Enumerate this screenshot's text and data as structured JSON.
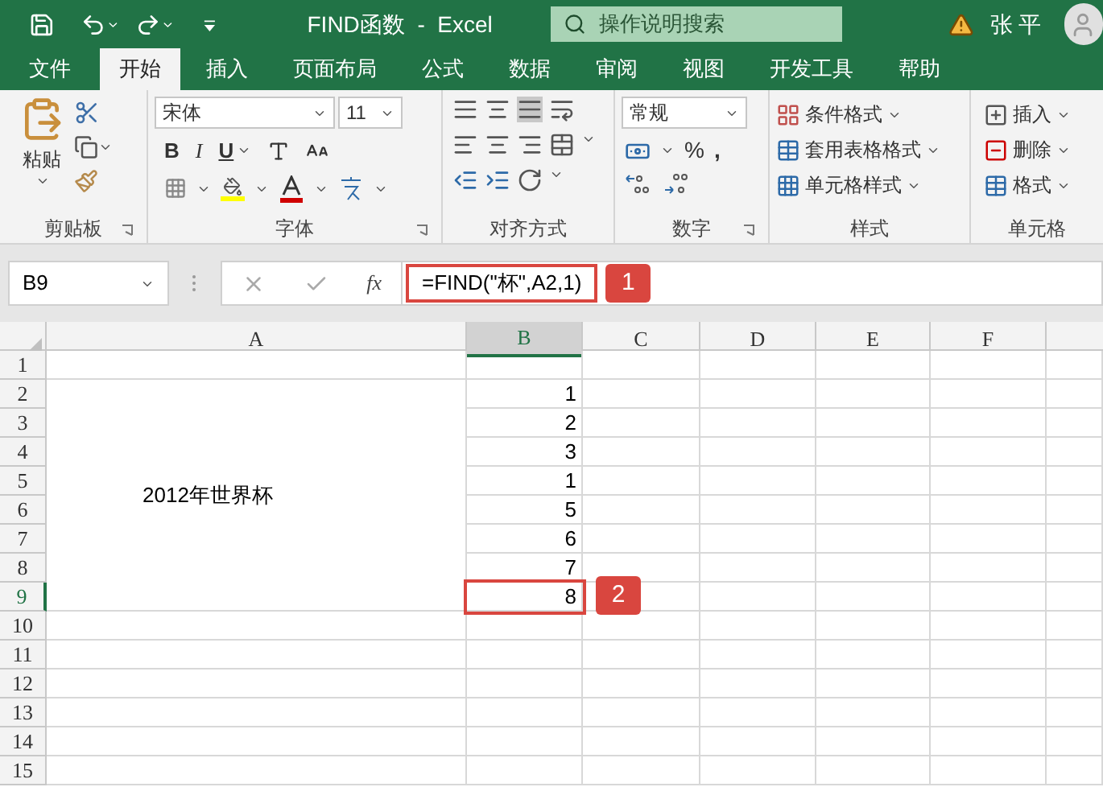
{
  "title_bar": {
    "title": "FIND函数  -  Excel",
    "search": {
      "placeholder": "操作说明搜索"
    },
    "user": "张 平"
  },
  "tabs": [
    {
      "label": "文件",
      "selected": false
    },
    {
      "label": "开始",
      "selected": true
    },
    {
      "label": "插入",
      "selected": false
    },
    {
      "label": "页面布局",
      "selected": false
    },
    {
      "label": "公式",
      "selected": false
    },
    {
      "label": "数据",
      "selected": false
    },
    {
      "label": "审阅",
      "selected": false
    },
    {
      "label": "视图",
      "selected": false
    },
    {
      "label": "开发工具",
      "selected": false
    },
    {
      "label": "帮助",
      "selected": false
    }
  ],
  "ribbon": {
    "clipboard": {
      "label": "剪贴板",
      "paste": "粘贴"
    },
    "font": {
      "label": "字体",
      "font_name": "宋体",
      "font_size": "11",
      "bold": "B",
      "italic": "I",
      "underline": "U"
    },
    "alignment": {
      "label": "对齐方式"
    },
    "number": {
      "label": "数字",
      "format": "常规",
      "percent": "%",
      "comma": ","
    },
    "styles": {
      "label": "样式",
      "commands": [
        "条件格式",
        "套用表格格式",
        "单元格样式"
      ]
    },
    "cells": {
      "label": "单元格",
      "commands": [
        "插入",
        "删除",
        "格式"
      ]
    }
  },
  "formula_bar": {
    "name_box": "B9",
    "function_button": "fx",
    "formula": "=FIND(\"杯\",A2,1)",
    "callout": "1"
  },
  "sheet": {
    "columns": [
      {
        "label": "A",
        "selected": false
      },
      {
        "label": "B",
        "selected": true
      },
      {
        "label": "C",
        "selected": false
      },
      {
        "label": "D",
        "selected": false
      },
      {
        "label": "E",
        "selected": false
      },
      {
        "label": "F",
        "selected": false
      }
    ],
    "merged_cell": {
      "text": "2012年世界杯"
    },
    "rows": [
      {
        "header": "1",
        "selected": false
      },
      {
        "header": "2",
        "selected": false,
        "b": "1"
      },
      {
        "header": "3",
        "selected": false,
        "b": "2"
      },
      {
        "header": "4",
        "selected": false,
        "b": "3"
      },
      {
        "header": "5",
        "selected": false,
        "b": "1"
      },
      {
        "header": "6",
        "selected": false,
        "b": "5"
      },
      {
        "header": "7",
        "selected": false,
        "b": "6"
      },
      {
        "header": "8",
        "selected": false,
        "b": "7"
      },
      {
        "header": "9",
        "selected": true,
        "b": "8",
        "active": true,
        "callout": "2"
      },
      {
        "header": "10",
        "selected": false
      },
      {
        "header": "11",
        "selected": false
      },
      {
        "header": "12",
        "selected": false
      },
      {
        "header": "13",
        "selected": false
      },
      {
        "header": "14",
        "selected": false
      },
      {
        "header": "15",
        "selected": false
      }
    ]
  }
}
